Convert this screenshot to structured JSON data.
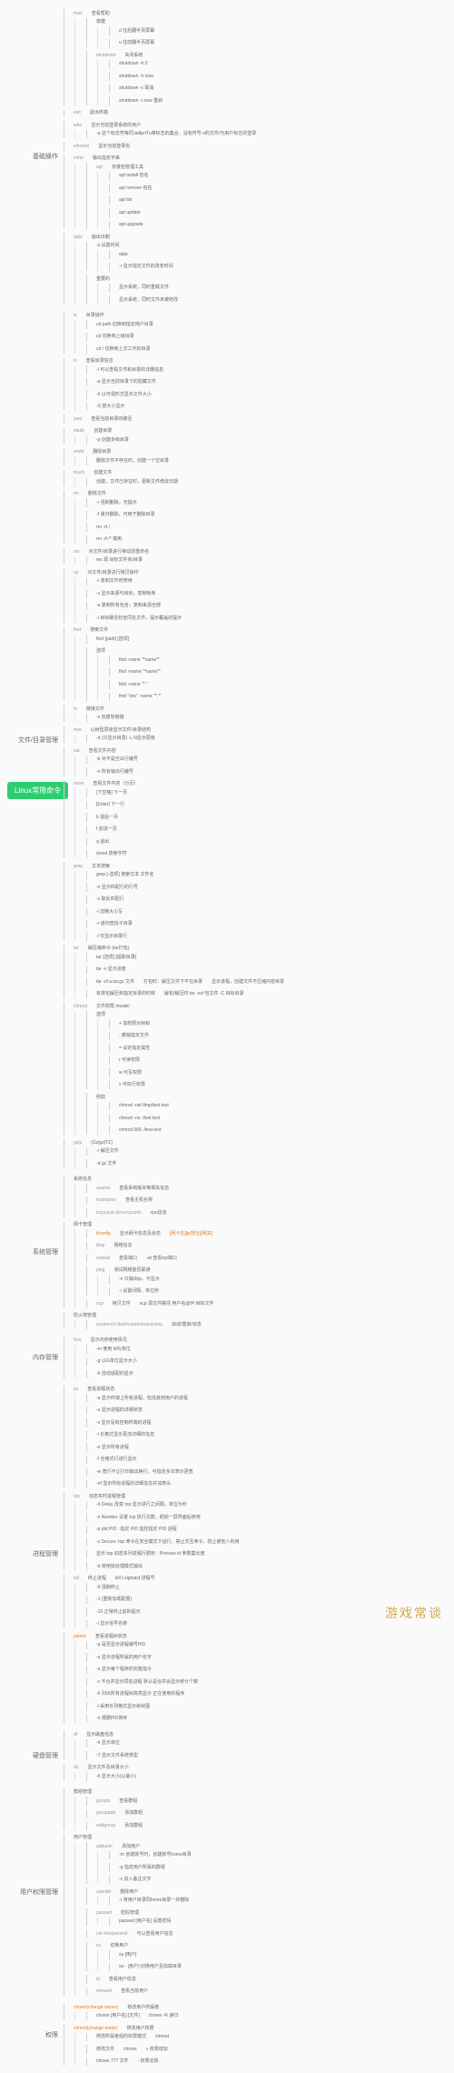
{
  "root": "Linux常用命令",
  "watermark": "游戏常谈",
  "light_watermark": "Yivian",
  "sections": [
    {
      "name": "基础操作",
      "children": [
        {
          "cmd": "man",
          "desc": "查看帮助",
          "children": [
            {
              "label": "按键",
              "children": [
                {
                  "label": "d 往后翻半页屏幕"
                },
                {
                  "label": "u 往前翻半页屏幕"
                }
              ]
            },
            {
              "cmd": "shutdown",
              "desc": "关闭系统",
              "children": [
                {
                  "label": "shutdown -h 0"
                },
                {
                  "label": "shutdown -h now"
                },
                {
                  "label": "shutdown -c 取消"
                },
                {
                  "label": "shutdown -r now 重启"
                }
              ]
            }
          ]
        },
        {
          "cmd": "exit",
          "desc": "退出终端"
        },
        {
          "cmd": "who",
          "desc": "显示当前登录系统的用户",
          "children": [
            {
              "label": "-a 这个标志符等同-bdlprtTu等标志的集合，没有符号-x的文件/与用户标志的登录"
            }
          ]
        },
        {
          "cmd": "whoami",
          "desc": "显示当前登录名"
        },
        {
          "cmd": "echo",
          "desc": "输出指定字串",
          "children": [
            {
              "cmd": "apt",
              "desc": "安装包管理工具",
              "children": [
                {
                  "label": "apt install 包名"
                },
                {
                  "label": "apt remove 包名"
                },
                {
                  "label": "apt list"
                },
                {
                  "label": "apt update"
                },
                {
                  "label": "apt upgrade"
                }
              ]
            }
          ]
        },
        {
          "cmd": "date",
          "desc": "输出日期",
          "children": [
            {
              "label": "-s 设置时间",
              "children": [
                {
                  "label": "date"
                },
                {
                  "label": "-r 显示指定文件的改变时间"
                }
              ]
            },
            {
              "label": "重要的",
              "children": [
                {
                  "label": "显示系统，同时重载文件"
                },
                {
                  "label": "显示系统，同时文件未被修改"
                }
              ]
            }
          ]
        }
      ]
    },
    {
      "name": "文件/目录管理",
      "children": [
        {
          "cmd": "ls",
          "desc": "目录操作",
          "children": [
            {
              "label": "cd path 切换到指定用户目录"
            },
            {
              "label": "cd 切换到上级目录"
            },
            {
              "label": "cd / 切换到上次工作的目录"
            }
          ]
        },
        {
          "cmd": "ls",
          "desc": "查看目录信息",
          "children": [
            {
              "label": "-l 可以查看文件和目录的详细信息"
            },
            {
              "label": "-a 显示当前目录下的隐藏文件"
            },
            {
              "label": "-h 以可视形式显示文件大小"
            },
            {
              "label": "-S 按大小显示"
            }
          ]
        },
        {
          "cmd": "pwd",
          "desc": "查看当前目录的路径"
        },
        {
          "cmd": "mkdir",
          "desc": "创建目录",
          "children": [
            {
              "label": "-p 创建多级目录"
            }
          ]
        },
        {
          "cmd": "rmdir",
          "desc": "删除目录",
          "children": [
            {
              "label": "删除文件不存在时，创建一个空目录"
            }
          ]
        },
        {
          "cmd": "touch",
          "desc": "创建文件",
          "children": [
            {
              "label": "创建，文件已存在时，更新文件修改日期"
            }
          ]
        },
        {
          "cmd": "rm",
          "desc": "删除文件",
          "children": [
            {
              "label": "-r 强制删除，无提示"
            },
            {
              "label": "-f 递归删除，可用于删除目录"
            },
            {
              "label": "rm -rf /"
            },
            {
              "label": "rm -rf /* 慎用"
            }
          ]
        },
        {
          "cmd": "mv",
          "desc": "对文件/目录进行移动改重命名",
          "children": [
            {
              "label": "mv 源 目标文件夹/目录"
            }
          ]
        },
        {
          "cmd": "cp",
          "desc": "对文件/目录进行拷贝操作",
          "children": [
            {
              "label": "-r 复制文件时使用"
            },
            {
              "label": "-v 显示来源与目标，复制哈希"
            },
            {
              "label": "-a 复制所有包含，复制来源全部"
            },
            {
              "label": "-i 目标路径包含同名文件，提示覆盖的提示"
            }
          ]
        },
        {
          "cmd": "find",
          "desc": "搜索文件",
          "children": [
            {
              "label": "find [path] [选项]"
            },
            {
              "label": "选项",
              "children": [
                {
                  "label": "find -name \"*name*\""
                },
                {
                  "label": "find -iname \"*name*\""
                },
                {
                  "label": "find -name \"*.\""
                },
                {
                  "label": "find \"/etc\" -name \"*.*\""
                }
              ]
            }
          ]
        },
        {
          "cmd": "ln",
          "desc": "链接文件",
          "children": [
            {
              "label": "-s 创建软链接"
            }
          ]
        },
        {
          "cmd": "tree",
          "desc": "以树型层级显示文件/目录结构",
          "children": [
            {
              "label": "-d (只显示目录)   -L N显示层级"
            }
          ]
        },
        {
          "cmd": "cat",
          "desc": "查看文件内容",
          "children": [
            {
              "label": "-b 对不是空白行编号"
            },
            {
              "label": "-n 所有输出行编号"
            }
          ]
        },
        {
          "cmd": "more",
          "desc": "查看文件内容（分页）",
          "children": [
            {
              "label": "[下空格] 下一页"
            },
            {
              "label": "[Enter] 下一行"
            },
            {
              "label": "b 退后一页"
            },
            {
              "label": "f 前进一页"
            },
            {
              "label": "q 退出"
            },
            {
              "label": "/word 搜索字符"
            }
          ]
        },
        {
          "cmd": "grep",
          "desc": "文本搜索",
          "children": [
            {
              "label": "grep [-选项] 搜索文本 文件名"
            },
            {
              "label": "-n 显示匹配行的行号"
            },
            {
              "label": "-v 取反匹配行"
            },
            {
              "label": "-i 忽略大小写"
            },
            {
              "label": "-r 递归查找子目录"
            },
            {
              "label": "-l 仅显示目录行"
            }
          ]
        },
        {
          "cmd": "tar",
          "desc": "解压缩命令 (tar打包)",
          "children": [
            {
              "label": "tar [选项] [提取目录]"
            },
            {
              "label": "tar -v 显示进度"
            },
            {
              "label": "打包时：解压文件下不在目录",
              "desc": "tar -cf a.tar.gz 文件",
              "note": "显示进程，创建文件不压缩内容目录"
            },
            {
              "label": "解包/解压时 tar -xvf 包文件 -C 目标目录",
              "desc": "有将包解压到指定目录的时候"
            }
          ]
        },
        {
          "cmd": "chmod",
          "desc": "文件权限 /mode/",
          "children": [
            {
              "label": "选项",
              "children": [
                {
                  "label": "+ 加权限对目标"
                },
                {
                  "label": "- 撤销指定文件"
                },
                {
                  "label": "= 设定指定属性"
                },
                {
                  "label": "r 可读权限"
                },
                {
                  "label": "w 可写权限"
                },
                {
                  "label": "x 可执行权限"
                }
              ]
            },
            {
              "label": "例如",
              "children": [
                {
                  "label": "chmod -rwf /tmp/test.test"
                },
                {
                  "label": "chmod -rw ./test text"
                },
                {
                  "label": "chmod 666 ./test text"
                }
              ]
            }
          ]
        },
        {
          "cmd": "gzip",
          "desc": "(Gz|gz|TZ)",
          "children": [
            {
              "label": "-r 解压文件"
            },
            {
              "label": "-d gz 文件"
            }
          ]
        }
      ]
    },
    {
      "name": "系统管理",
      "children": [
        {
          "label": "系统信息",
          "children": [
            {
              "cmd": "uname",
              "desc": "查看系统版本等相关信息"
            },
            {
              "cmd": "hostname",
              "desc": "查看主机名称"
            },
            {
              "cmd": "lscpu|cat /proc/cpuinfo",
              "desc": "cpu信息"
            }
          ]
        },
        {
          "label": "网卡管理",
          "children": [
            {
              "cmd": "ifconfig",
              "desc": "显示网卡信息及状态",
              "note": "[网卡名][ip地址][网关]",
              "orange": true
            },
            {
              "cmd": "iftop",
              "desc": "网络信息"
            },
            {
              "cmd": "netstat",
              "desc": "查看端口",
              "note": "-at 查看tcp端口"
            },
            {
              "cmd": "ping",
              "desc": "测试网络能否联通",
              "children": [
                {
                  "label": "-n 只输出ip，不显示"
                },
                {
                  "label": "-i 设置间隔，单位秒"
                }
              ]
            },
            {
              "cmd": "scp",
              "desc": "拷贝文件",
              "note": "scp 源文件路径 用户名@IP:目标文件"
            }
          ]
        },
        {
          "label": "防火墙管理",
          "children": [
            {
              "cmd": "systemctl start/restart/status/stop",
              "desc": "启动/重启/状态"
            }
          ]
        }
      ]
    },
    {
      "name": "内存管理",
      "children": [
        {
          "cmd": "free",
          "desc": "显示内存使用情况",
          "children": [
            {
              "label": "-m 使用 M为单位"
            },
            {
              "label": "-g 以G单位显示大小"
            },
            {
              "label": "-h 自动适配的显示"
            }
          ]
        }
      ]
    },
    {
      "name": "进程管理",
      "children": [
        {
          "cmd": "ps",
          "desc": "查看进程状态",
          "children": [
            {
              "label": "-a 显示终端上所有进程，包括其他用户的进程"
            },
            {
              "label": "-u 显示进程的详细状态"
            },
            {
              "label": "-x 显示没有控制终端的进程"
            },
            {
              "label": "-l 长格式显示更加详细的信息"
            },
            {
              "label": "-e 显示所有进程"
            },
            {
              "label": "-f 全格式行进行显示"
            },
            {
              "label": "-w 宽行不让打印输出换行，可指定多次表示更宽"
            },
            {
              "label": "-ef 显示所有进程的详细信息并加表头"
            }
          ]
        },
        {
          "cmd": "top",
          "desc": "动态实时进程管理",
          "children": [
            {
              "label": "-d Delay 改变 top 显示进行之间隔，单位为秒"
            },
            {
              "label": "-n Number 设置 top 执行次数，刷完一屏界面后使用"
            },
            {
              "label": "-p pid PID : 指定 PID 监控指定 PID 进程"
            },
            {
              "label": "-s Secure: top 命令在安全模式下运行，禁止交互命令，防止被他人利用"
            },
            {
              "label": "显示 top 动态多列进程行顺序：Process id 参数集长度"
            },
            {
              "label": "-b 使用批处理模式输出"
            }
          ]
        },
        {
          "cmd": "kill",
          "desc": "终止进程",
          "note": "kill [-signals] 进程号",
          "children": [
            {
              "label": "-9 强制终止"
            },
            {
              "label": "-1 (重新加载配置)"
            },
            {
              "label": "-15 正常终止前的提示"
            },
            {
              "label": "-l 显示信号名称"
            }
          ]
        },
        {
          "cmd": "pstree",
          "desc": "查看进程树状态",
          "orange": true,
          "children": [
            {
              "label": "-p 是否显示进程编号PID"
            },
            {
              "label": "-u 显示进程所属的用户名字"
            },
            {
              "label": "-a 显示每个程序的完整指令"
            },
            {
              "label": "-c 不合并显示同名进程 默认是合并会显示统计个数"
            },
            {
              "label": "-h 列出所有进程树高亮显示 正在使用的程序"
            },
            {
              "label": "-l 采用长列格式显示树状图"
            },
            {
              "label": "-n 根据PID排序"
            }
          ]
        }
      ]
    },
    {
      "name": "硬盘管理",
      "children": [
        {
          "cmd": "df",
          "desc": "显示磁盘信息",
          "children": [
            {
              "label": "-h 显示单位"
            },
            {
              "label": "-T 显示文件系统类型"
            }
          ]
        },
        {
          "cmd": "du",
          "desc": "显示文件及目录大小",
          "children": [
            {
              "label": "-h 显示大小(以最小)"
            }
          ]
        }
      ]
    },
    {
      "name": "用户权限管理",
      "children": [
        {
          "label": "群组管理",
          "children": [
            {
              "cmd": "groups",
              "desc": "查看群组"
            },
            {
              "cmd": "groupadd",
              "desc": "添加群组"
            },
            {
              "cmd": "addgroup",
              "desc": "添加群组"
            }
          ]
        },
        {
          "label": "用户管理",
          "children": [
            {
              "cmd": "adduser",
              "desc": "添加用户",
              "children": [
                {
                  "label": "-m 创建账号时，创建账号home目录"
                },
                {
                  "label": "-g 指定用户所属的群组"
                },
                {
                  "label": "-c 加入备注文字"
                }
              ]
            },
            {
              "cmd": "userdel",
              "desc": "删除用户",
              "children": [
                {
                  "label": "-r 将用户目录同home目录一并删除"
                }
              ]
            },
            {
              "cmd": "passwd",
              "desc": "密码管理",
              "children": [
                {
                  "label": "passwd [用户名] 设置密码"
                }
              ]
            },
            {
              "cmd": "cat /etc/passwd",
              "desc": "可以查看用户信息"
            },
            {
              "cmd": "su",
              "desc": "切换用户",
              "children": [
                {
                  "label": "su [用户]"
                },
                {
                  "label": "su - [用户] 切换用户且加载目录"
                }
              ]
            },
            {
              "cmd": "id",
              "desc": "查看用户信息"
            },
            {
              "cmd": "whoami",
              "desc": "查看当前用户"
            }
          ]
        }
      ]
    },
    {
      "name": "权限",
      "children": [
        {
          "cmd": "chown(change owner)",
          "desc": "修改用户所属者",
          "orange": true,
          "children": [
            {
              "label": "chown [用户名] [文件]",
              "note": "chown -R 递归"
            }
          ]
        },
        {
          "cmd": "chmod(change mode)",
          "desc": "修改用户权限",
          "orange": true,
          "children": [
            {
              "label": "chmod",
              "desc": "修改所属者组的权限模式"
            },
            {
              "label": "chown",
              "desc": "修改文件",
              "note": "+ 权限增加"
            },
            {
              "label": "chown 777 文件",
              "note": "- 权限去除"
            }
          ]
        }
      ]
    }
  ]
}
